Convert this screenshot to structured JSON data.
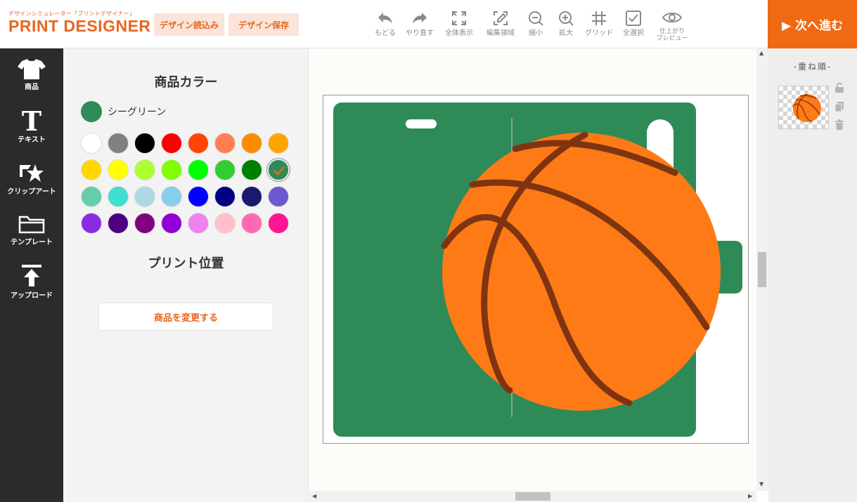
{
  "header": {
    "logo_sub": "デザインシミュレーター「プリントデザイナー」",
    "logo_main": "PRINT DESIGNER",
    "load_label": "デザイン読込み",
    "save_label": "デザイン保存",
    "tools": [
      {
        "label": "もどる",
        "icon": "undo-icon"
      },
      {
        "label": "やり直す",
        "icon": "redo-icon"
      },
      {
        "label": "全体表示",
        "icon": "fit-view-icon"
      },
      {
        "label": "編集領域",
        "icon": "edit-area-icon"
      },
      {
        "label": "縮小",
        "icon": "zoom-out-icon"
      },
      {
        "label": "拡大",
        "icon": "zoom-in-icon"
      },
      {
        "label": "グリッド",
        "icon": "grid-icon"
      },
      {
        "label": "全選択",
        "icon": "select-all-icon"
      },
      {
        "label1": "仕上がり",
        "label2": "プレビュー",
        "icon": "preview-eye-icon"
      }
    ],
    "next_label": "▶ 次へ進む"
  },
  "sidebar": {
    "items": [
      {
        "label": "商品",
        "icon": "tshirt-icon"
      },
      {
        "label": "テキスト",
        "icon": "text-icon"
      },
      {
        "label": "クリップアート",
        "icon": "clipart-icon"
      },
      {
        "label": "テンプレート",
        "icon": "folder-icon"
      },
      {
        "label": "アップロード",
        "icon": "upload-icon"
      }
    ]
  },
  "panel": {
    "color_title": "商品カラー",
    "current_color_name": "シーグリーン",
    "current_color": "#2e8b57",
    "colors": [
      "#ffffff",
      "#808080",
      "#000000",
      "#ff0000",
      "#ff4500",
      "#ff7f50",
      "#ff8c00",
      "#ffa500",
      "#ffd700",
      "#ffff00",
      "#adff2f",
      "#7fff00",
      "#00ff00",
      "#32cd32",
      "#008000",
      "#2e8b57",
      "#66cdaa",
      "#40e0d0",
      "#add8e6",
      "#87ceeb",
      "#0000ff",
      "#000080",
      "#191970",
      "#6a5acd",
      "#8a2be2",
      "#4b0082",
      "#800080",
      "#9400d3",
      "#ee82ee",
      "#ffc0cb",
      "#ff69b4",
      "#ff1493"
    ],
    "selected_color_index": 15,
    "print_position_title": "プリント位置",
    "change_product_label": "商品を変更する"
  },
  "right_panel": {
    "title": "-重ね順-"
  },
  "colors": {
    "accent": "#f06a14",
    "product": "#2e8b57",
    "ball": "#fe7a16",
    "ball_lines": "#7f3411"
  }
}
